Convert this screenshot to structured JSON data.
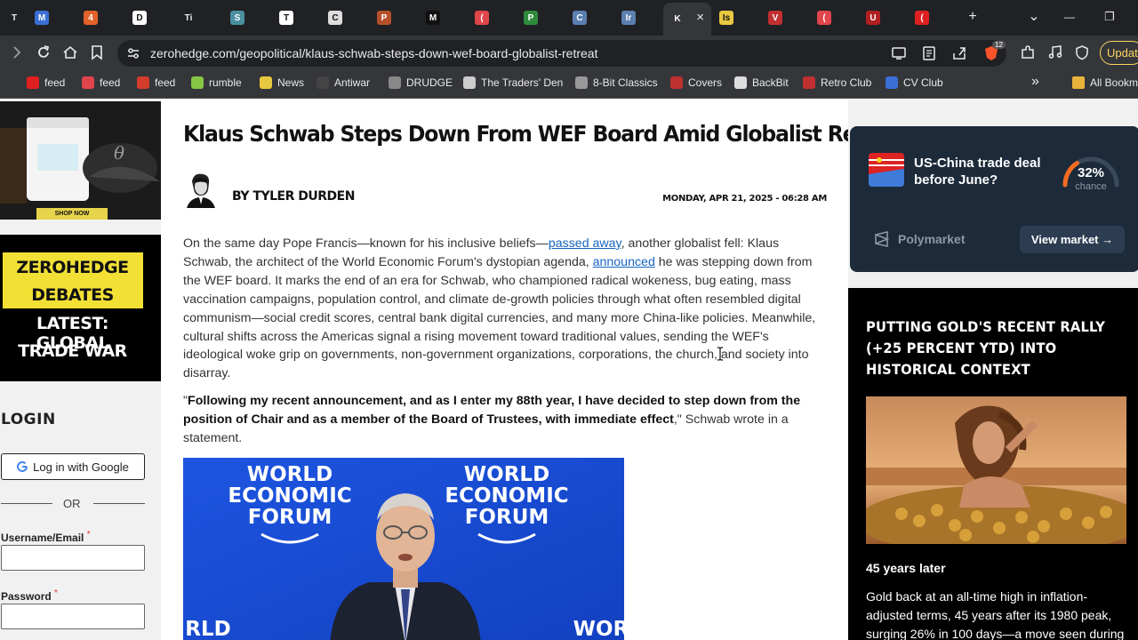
{
  "browser": {
    "tabs": [
      {
        "letter": "T",
        "color": "#202124",
        "text_color": "#e8eaed"
      },
      {
        "letter": "M",
        "color": "#3b6fd6",
        "text_color": "#ffffff"
      },
      {
        "letter": "4",
        "color": "#e2622b",
        "text_color": "#ffffff"
      },
      {
        "letter": "D",
        "color": "#ffffff",
        "text_color": "#111111"
      },
      {
        "letter": "Ti",
        "color": "#202124",
        "text_color": "#e8eaed"
      },
      {
        "letter": "S",
        "color": "#4a8fa0",
        "text_color": "#ffffff"
      },
      {
        "letter": "T",
        "color": "#ffffff",
        "text_color": "#111111"
      },
      {
        "letter": "C",
        "color": "#dddddd",
        "text_color": "#111111"
      },
      {
        "letter": "P",
        "color": "#b5502b",
        "text_color": "#ffffff"
      },
      {
        "letter": "M",
        "color": "#111111",
        "text_color": "#ffffff"
      },
      {
        "letter": "(",
        "color": "#e0454b",
        "text_color": "#ffffff"
      },
      {
        "letter": "P",
        "color": "#2e8b3c",
        "text_color": "#ffffff"
      },
      {
        "letter": "C",
        "color": "#5b7fb0",
        "text_color": "#ffffff"
      },
      {
        "letter": "Ir",
        "color": "#5b7fb0",
        "text_color": "#ffffff"
      },
      {
        "letter": "K",
        "color": "#35363a",
        "text_color": "#ffffff",
        "active": true
      },
      {
        "letter": "Is",
        "color": "#e8c840",
        "text_color": "#111111"
      },
      {
        "letter": "V",
        "color": "#c03030",
        "text_color": "#ffffff"
      },
      {
        "letter": "(",
        "color": "#e0454b",
        "text_color": "#ffffff"
      },
      {
        "letter": "U",
        "color": "#b02020",
        "text_color": "#ffffff"
      },
      {
        "letter": "(",
        "color": "#e02020",
        "text_color": "#ffffff"
      }
    ],
    "new_tab_symbol": "+",
    "tab_search_symbol": "⌄",
    "minimize_symbol": "—",
    "maximize_symbol": "❐",
    "url": "zerohedge.com/geopolitical/klaus-schwab-steps-down-wef-board-globalist-retreat",
    "brave_badge": "12",
    "update_label": "Update"
  },
  "bookmarks": [
    {
      "label": "feed",
      "icon_color": "#e02020"
    },
    {
      "label": "feed",
      "icon_color": "#e0454b"
    },
    {
      "label": "feed",
      "icon_color": "#d43c2c"
    },
    {
      "label": "rumble",
      "icon_color": "#85c742"
    },
    {
      "label": "News",
      "icon_color": "#e8c840"
    },
    {
      "label": "Antiwar",
      "icon_color": "#444444"
    },
    {
      "label": "DRUDGE",
      "icon_color": "#888888"
    },
    {
      "label": "The Traders' Den",
      "icon_color": "#cccccc"
    },
    {
      "label": "8-Bit Classics",
      "icon_color": "#999999"
    },
    {
      "label": "Covers",
      "icon_color": "#c03030"
    },
    {
      "label": "BackBit",
      "icon_color": "#dddddd"
    },
    {
      "label": "Retro Club",
      "icon_color": "#c03030"
    },
    {
      "label": "CV Club",
      "icon_color": "#3b6fd6"
    }
  ],
  "bookmarks_overflow": "»",
  "all_bookmarks_label": "All Bookm",
  "left": {
    "ad_button": "SHOP NOW",
    "debates_lines": [
      "ZEROHEDGE",
      "DEBATES",
      "LATEST: GLOBAL",
      "TRADE WAR"
    ],
    "login_heading": "LOGIN",
    "google_button": "Log in with Google",
    "or_label": "OR",
    "username_label": "Username/Email",
    "password_label": "Password",
    "required_mark": "*"
  },
  "article": {
    "headline": "Klaus Schwab Steps Down From WEF Board Amid Globalist Retreat",
    "byline": "BY TYLER DURDEN",
    "date": "MONDAY, APR 21, 2025 - 06:28 AM",
    "p1_a": "On the same day Pope Francis—known for his inclusive beliefs—",
    "p1_link1": "passed away",
    "p1_b": ", another globalist fell: Klaus Schwab, the architect of the World Economic Forum's dystopian agenda, ",
    "p1_link2": "announced",
    "p1_c": " he was stepping down from the WEF board. It marks the end of an era for Schwab, who championed radical wokeness, bug eating, mass vaccination campaigns, population control, and climate de-growth policies through what often resembled digital communism—social credit scores, central bank digital currencies, and many more China-like policies. Meanwhile, cultural shifts across the Americas signal a rising movement toward traditional values, sending the WEF's ideological woke grip on governments, non-government organizations, corporations, the church, and society into disarray.",
    "quote_open": "\"",
    "quote_bold": "Following my recent announcement, and as I enter my 88th year, I have decided to step down from the position of Chair and as a member of the Board of Trustees, with immediate effect",
    "quote_close": ",\" Schwab wrote in a statement.",
    "photo_caption_left": [
      "WORLD",
      "ECONOMIC",
      "FORUM"
    ],
    "photo_caption_right": [
      "WORLD",
      "ECONOMIC",
      "FORUM"
    ],
    "photo_bottom_left": "RLD",
    "photo_bottom_right": "WOR"
  },
  "right": {
    "poly_question": "US-China trade deal before June?",
    "poly_percent": "32%",
    "poly_percent_value": 32,
    "poly_chance": "chance",
    "poly_brand": "Polymarket",
    "poly_view": "View market →",
    "gold_title": "PUTTING GOLD'S RECENT RALLY (+25 PERCENT YTD) INTO HISTORICAL CONTEXT",
    "gold_subtitle": "45 years later",
    "gold_text": "Gold back at an all-time high in inflation-adjusted terms, 45 years after its 1980 peak, surging 26% in 100 days—a move seen during"
  },
  "colors": {
    "accent_link": "#1565c0",
    "debates_yellow": "#f2e035",
    "poly_bg": "#1c2a3a",
    "gauge_orange": "#f26b21"
  }
}
